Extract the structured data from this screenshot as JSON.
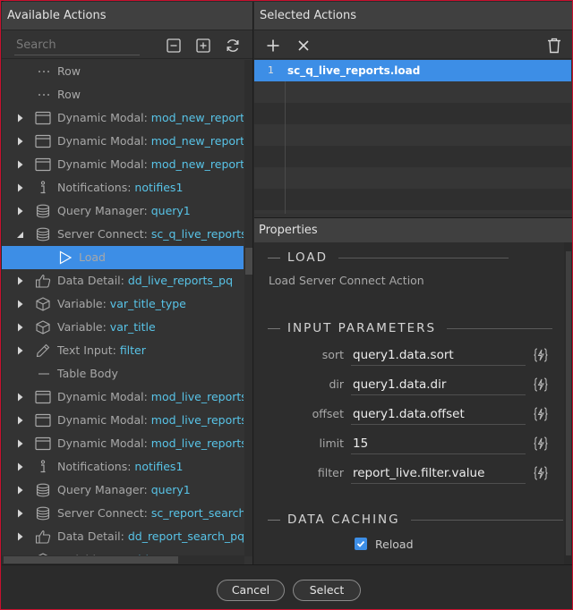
{
  "available_actions": {
    "title": "Available Actions",
    "search_placeholder": "Search",
    "tree": [
      {
        "type": "plain",
        "icon": "dots-icon",
        "label": "Row",
        "value": ""
      },
      {
        "type": "plain",
        "icon": "dots-icon",
        "label": "Row",
        "value": ""
      },
      {
        "type": "node",
        "icon": "modal-icon",
        "label": "Dynamic Modal: ",
        "value": "mod_new_report_in"
      },
      {
        "type": "node",
        "icon": "modal-icon",
        "label": "Dynamic Modal: ",
        "value": "mod_new_report_ed"
      },
      {
        "type": "node",
        "icon": "modal-icon",
        "label": "Dynamic Modal: ",
        "value": "mod_new_report_de"
      },
      {
        "type": "node",
        "icon": "info-icon",
        "label": "Notifications: ",
        "value": "notifies1"
      },
      {
        "type": "node",
        "icon": "database-icon",
        "label": "Query Manager: ",
        "value": "query1"
      },
      {
        "type": "expanded",
        "icon": "database-icon",
        "label": "Server Connect: ",
        "value": "sc_q_live_reports"
      },
      {
        "type": "child",
        "icon": "play-icon",
        "label": "Load",
        "value": ""
      },
      {
        "type": "node",
        "icon": "thumb-icon",
        "label": "Data Detail: ",
        "value": "dd_live_reports_pq"
      },
      {
        "type": "node",
        "icon": "cube-icon",
        "label": "Variable: ",
        "value": "var_title_type"
      },
      {
        "type": "node",
        "icon": "cube-icon",
        "label": "Variable: ",
        "value": "var_title"
      },
      {
        "type": "node",
        "icon": "pencil-icon",
        "label": "Text Input: ",
        "value": "filter"
      },
      {
        "type": "plain",
        "icon": "dash-icon",
        "label": "Table Body",
        "value": ""
      },
      {
        "type": "node",
        "icon": "modal-icon",
        "label": "Dynamic Modal: ",
        "value": "mod_live_reports_in"
      },
      {
        "type": "node",
        "icon": "modal-icon",
        "label": "Dynamic Modal: ",
        "value": "mod_live_reports_ec"
      },
      {
        "type": "node",
        "icon": "modal-icon",
        "label": "Dynamic Modal: ",
        "value": "mod_live_reports_de"
      },
      {
        "type": "node",
        "icon": "info-icon",
        "label": "Notifications: ",
        "value": "notifies1"
      },
      {
        "type": "node",
        "icon": "database-icon",
        "label": "Query Manager: ",
        "value": "query1"
      },
      {
        "type": "node",
        "icon": "database-icon",
        "label": "Server Connect: ",
        "value": "sc_report_search_pq"
      },
      {
        "type": "node",
        "icon": "thumb-icon",
        "label": "Data Detail: ",
        "value": "dd_report_search_pq"
      },
      {
        "type": "node",
        "icon": "cube-icon",
        "label": "Variable: ",
        "value": "var_title_type"
      }
    ]
  },
  "selected_actions": {
    "title": "Selected Actions",
    "rows": [
      {
        "num": "1",
        "name": "sc_q_live_reports.load"
      },
      {
        "num": "",
        "name": ""
      },
      {
        "num": "",
        "name": ""
      },
      {
        "num": "",
        "name": ""
      },
      {
        "num": "",
        "name": ""
      },
      {
        "num": "",
        "name": ""
      },
      {
        "num": "",
        "name": ""
      },
      {
        "num": "",
        "name": ""
      }
    ]
  },
  "properties": {
    "title": "Properties",
    "load_title": "LOAD",
    "load_desc": "Load Server Connect Action",
    "input_params_title": "INPUT PARAMETERS",
    "params": [
      {
        "label": "sort",
        "value": "query1.data.sort"
      },
      {
        "label": "dir",
        "value": "query1.data.dir"
      },
      {
        "label": "offset",
        "value": "query1.data.offset"
      },
      {
        "label": "limit",
        "value": "15"
      },
      {
        "label": "filter",
        "value": "report_live.filter.value"
      }
    ],
    "data_caching_title": "DATA CACHING",
    "reload_label": "Reload",
    "reload_checked": true
  },
  "footer": {
    "cancel_label": "Cancel",
    "select_label": "Select"
  },
  "colors": {
    "accent": "#3d8ee6",
    "value_text": "#58c4e8",
    "window_border": "#c8102e"
  }
}
